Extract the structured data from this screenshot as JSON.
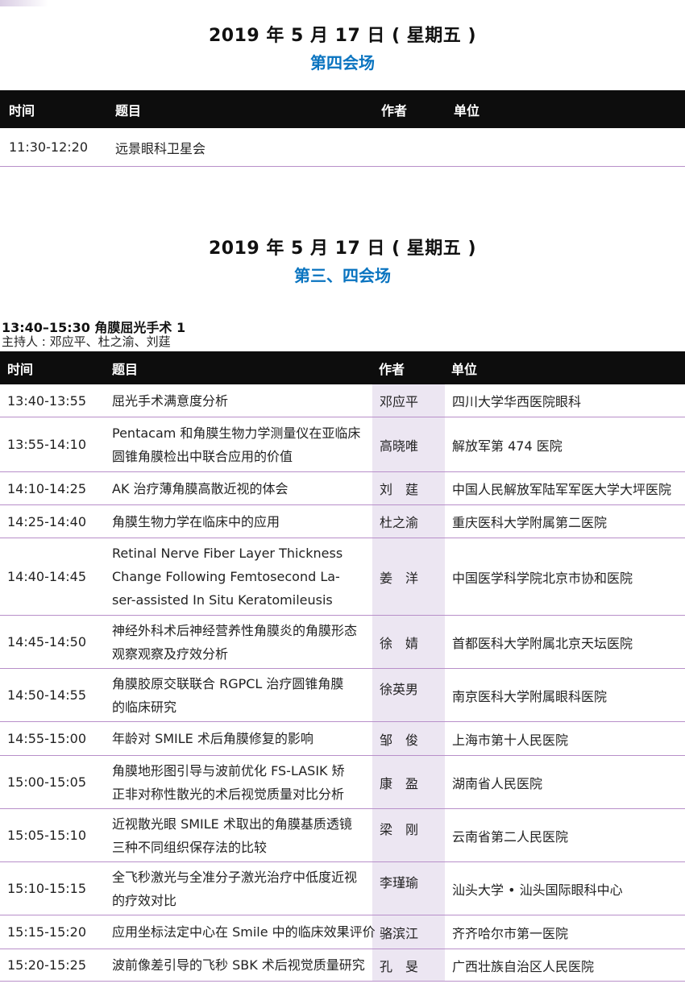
{
  "section1": {
    "date": "2019 年 5 月 17 日 ( 星期五 )",
    "venue": "第四会场",
    "headers": {
      "time": "时间",
      "title": "题目",
      "author": "作者",
      "unit": "单位"
    },
    "rows": [
      {
        "time": "11:30-12:20",
        "title": "远景眼科卫星会",
        "author": "",
        "unit": ""
      }
    ]
  },
  "section2": {
    "date": "2019 年 5 月 17 日 ( 星期五 )",
    "venue": "第三、四会场",
    "session": "13:40–15:30  角膜屈光手术 1",
    "hosts": "主持人 : 邓应平、杜之渝、刘莛",
    "headers": {
      "time": "时间",
      "title": "题目",
      "author": "作者",
      "unit": "单位"
    },
    "rows": [
      {
        "time": "13:40-13:55",
        "title": [
          "屈光手术满意度分析"
        ],
        "author": "邓应平",
        "unit": "四川大学华西医院眼科"
      },
      {
        "time": "13:55-14:10",
        "title": [
          "Pentacam 和角膜生物力学测量仪在亚临床",
          "圆锥角膜检出中联合应用的价值"
        ],
        "author": "高晓唯",
        "unit": "解放军第 474 医院"
      },
      {
        "time": "14:10-14:25",
        "title": [
          "AK 治疗薄角膜高散近视的体会"
        ],
        "author": "刘　莛",
        "unit": "中国人民解放军陆军军医大学大坪医院"
      },
      {
        "time": "14:25-14:40",
        "title": [
          "角膜生物力学在临床中的应用"
        ],
        "author": "杜之渝",
        "unit": "重庆医科大学附属第二医院"
      },
      {
        "time": "14:40-14:45",
        "title": [
          "Retinal Nerve Fiber Layer Thickness",
          "Change Following Femtosecond La-",
          "ser-assisted In Situ Keratomileusis"
        ],
        "author": "姜　洋",
        "unit": "中国医学科学院北京市协和医院"
      },
      {
        "time": "14:45-14:50",
        "title": [
          "神经外科术后神经营养性角膜炎的角膜形态",
          "观察观察及疗效分析"
        ],
        "author": "徐　婧",
        "unit": "首都医科大学附属北京天坛医院"
      },
      {
        "time": "14:50-14:55",
        "title": [
          "角膜胶原交联联合 RGPCL 治疗圆锥角膜",
          "的临床研究"
        ],
        "author": "徐英男",
        "unit": "南京医科大学附属眼科医院"
      },
      {
        "time": "14:55-15:00",
        "title": [
          "年龄对 SMILE 术后角膜修复的影响"
        ],
        "author": "邹　俊",
        "unit": "上海市第十人民医院"
      },
      {
        "time": "15:00-15:05",
        "title": [
          "角膜地形图引导与波前优化 FS-LASIK 矫",
          "正非对称性散光的术后视觉质量对比分析"
        ],
        "author": "康　盈",
        "unit": "湖南省人民医院"
      },
      {
        "time": "15:05-15:10",
        "title": [
          "近视散光眼 SMILE 术取出的角膜基质透镜",
          "三种不同组织保存法的比较"
        ],
        "author": "梁　刚",
        "unit": "云南省第二人民医院"
      },
      {
        "time": "15:10-15:15",
        "title": [
          "全飞秒激光与全准分子激光治疗中低度近视",
          "的疗效对比"
        ],
        "author": "李瑾瑜",
        "unit": "汕头大学 • 汕头国际眼科中心"
      },
      {
        "time": "15:15-15:20",
        "title": [
          "应用坐标法定中心在 Smile 中的临床效果评价"
        ],
        "author": "骆滨江",
        "unit": "齐齐哈尔市第一医院"
      },
      {
        "time": "15:20-15:25",
        "title": [
          "波前像差引导的飞秒 SBK 术后视觉质量研究"
        ],
        "author": "孔　旻",
        "unit": "广西壮族自治区人民医院"
      }
    ]
  }
}
